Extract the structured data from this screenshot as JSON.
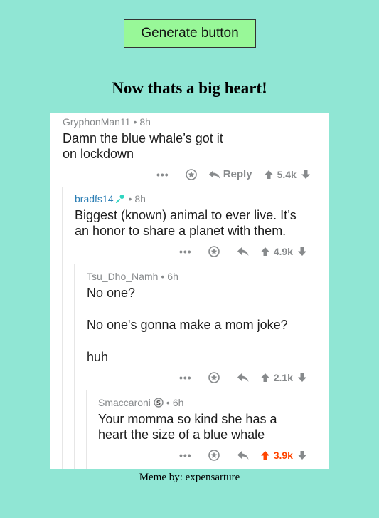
{
  "generate_button": {
    "label": "Generate button"
  },
  "meme": {
    "title": "Now thats a big heart!",
    "credit": "Meme by: expensarture"
  },
  "comments": [
    {
      "user": "GryphonMan11",
      "time": "8h",
      "lines": [
        "Damn the blue whale’s got it",
        "on lockdown"
      ],
      "reply_label": "Reply",
      "score": "5.4k"
    },
    {
      "user": "bradfs14",
      "time": "8h",
      "lines": [
        "Biggest (known) animal to ever live. It’s",
        "an honor to share a planet with them."
      ],
      "score": "4.9k"
    },
    {
      "user": "Tsu_Dho_Namh",
      "time": "6h",
      "paragraphs": [
        "No one?",
        "No one's gonna make a mom joke?",
        "huh"
      ],
      "score": "2.1k"
    },
    {
      "user": "Smaccaroni",
      "time": "6h",
      "lines": [
        "Your momma so kind she has a",
        "heart the size of a blue whale"
      ],
      "score": "3.9k",
      "score_color": "#ff4500"
    }
  ],
  "separator": "•",
  "more_label": "•••",
  "colors": {
    "background": "#90e6d4",
    "button": "#98f898",
    "upvoted": "#ff4500",
    "username_blue": "#2d7fb5"
  },
  "icons": [
    "more-icon",
    "award-icon",
    "reply-icon",
    "upvote-icon",
    "downvote-icon",
    "mic-icon",
    "badge-icon"
  ]
}
